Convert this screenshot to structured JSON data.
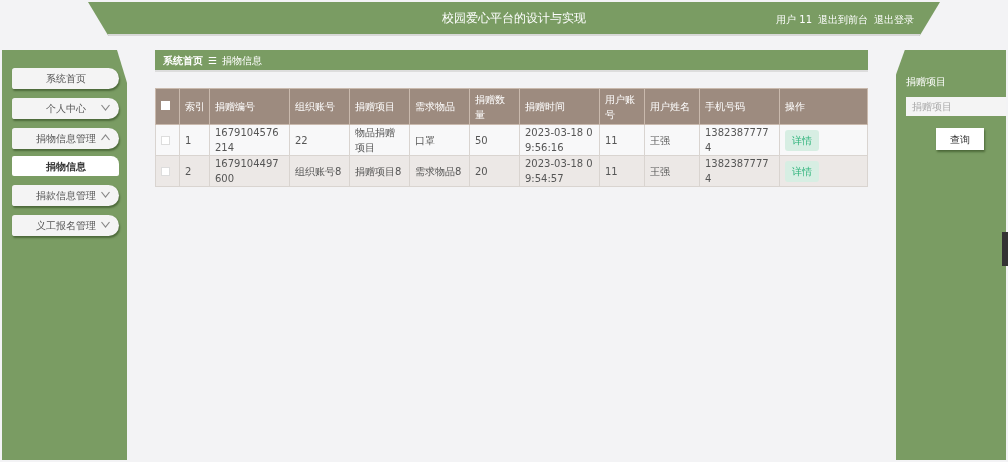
{
  "header": {
    "title": "校园爱心平台的设计与实现",
    "user": "用户 11",
    "links": [
      "退出到前台",
      "退出登录"
    ]
  },
  "sidebar": {
    "items": [
      {
        "label": "系统首页",
        "kind": "link"
      },
      {
        "label": "个人中心",
        "kind": "menu",
        "expanded": false
      },
      {
        "label": "捐物信息管理",
        "kind": "menu",
        "expanded": true,
        "children": [
          {
            "label": "捐物信息",
            "selected": true
          }
        ]
      },
      {
        "label": "捐款信息管理",
        "kind": "menu",
        "expanded": false
      },
      {
        "label": "义工报名管理",
        "kind": "menu",
        "expanded": false
      }
    ]
  },
  "breadcrumb": {
    "items": [
      "系统首页",
      "捐物信息"
    ],
    "separator": "☰"
  },
  "table": {
    "header_checked": false,
    "columns": [
      "索引",
      "捐赠编号",
      "组织账号",
      "捐赠项目",
      "需求物品",
      "捐赠数量",
      "捐赠时间",
      "用户账号",
      "用户姓名",
      "手机号码",
      "操作"
    ],
    "rows": [
      {
        "checked": false,
        "cells": [
          "1",
          "1679104576214",
          "22",
          "物品捐赠项目",
          "口罩",
          "50",
          "2023-03-18 09:56:16",
          "11",
          "王强",
          "13823877774"
        ],
        "action": "详情"
      },
      {
        "checked": false,
        "cells": [
          "2",
          "1679104497600",
          "组织账号8",
          "捐赠项目8",
          "需求物品8",
          "20",
          "2023-03-18 09:54:57",
          "11",
          "王强",
          "13823877774"
        ],
        "action": "详情"
      }
    ]
  },
  "search": {
    "label": "捐赠项目",
    "placeholder": "捐赠项目",
    "button": "查询"
  }
}
